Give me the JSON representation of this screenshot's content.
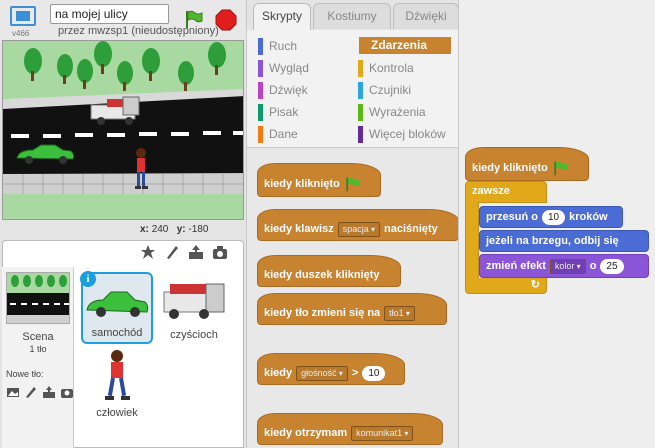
{
  "header": {
    "version": "v466",
    "project_title": "na mojej ulicy",
    "author": "przez mwzsp1 (nieudostępniony)"
  },
  "stage": {
    "x_label": "x:",
    "x_value": "240",
    "y_label": "y:",
    "y_value": "-180"
  },
  "sprites": {
    "stage_label": "Scena",
    "stage_backdrops": "1 tło",
    "new_backdrop_label": "Nowe tło:",
    "info_badge": "i",
    "items": [
      {
        "name": "samochód"
      },
      {
        "name": "czyścioch"
      },
      {
        "name": "człowiek"
      }
    ]
  },
  "tabs": [
    "Skrypty",
    "Kostiumy",
    "Dźwięki"
  ],
  "categories": [
    {
      "label": "Ruch",
      "color": "#4a6cd4"
    },
    {
      "label": "Zdarzenia",
      "color": "#c88330"
    },
    {
      "label": "Wygląd",
      "color": "#8a55d7"
    },
    {
      "label": "Kontrola",
      "color": "#e1a91a"
    },
    {
      "label": "Dźwięk",
      "color": "#bb42c3"
    },
    {
      "label": "Czujniki",
      "color": "#2ca5e2"
    },
    {
      "label": "Pisak",
      "color": "#0e9a6c"
    },
    {
      "label": "Wyrażenia",
      "color": "#5cb712"
    },
    {
      "label": "Dane",
      "color": "#ee7d16"
    },
    {
      "label": "Więcej bloków",
      "color": "#632d99"
    }
  ],
  "palette": {
    "when_flag": "kiedy kliknięto",
    "when_key": "kiedy klawisz",
    "key_option": "spacja",
    "key_suffix": "naciśnięty",
    "when_sprite": "kiedy duszek kliknięty",
    "when_backdrop": "kiedy tło zmieni się na",
    "backdrop_option": "tło1",
    "when_gt": "kiedy",
    "gt_option": "głośność",
    "gt_symbol": ">",
    "gt_value": "10",
    "when_receive": "kiedy otrzymam",
    "receive_option": "komunikat1"
  },
  "script": {
    "hat": "kiedy kliknięto",
    "forever": "zawsze",
    "move_prefix": "przesuń o",
    "move_value": "10",
    "move_suffix": "kroków",
    "bounce": "jeżeli na brzegu, odbij się",
    "effect_prefix": "zmień efekt",
    "effect_option": "kolor",
    "effect_by": "o",
    "effect_value": "25",
    "loop_arrow": "↻"
  }
}
